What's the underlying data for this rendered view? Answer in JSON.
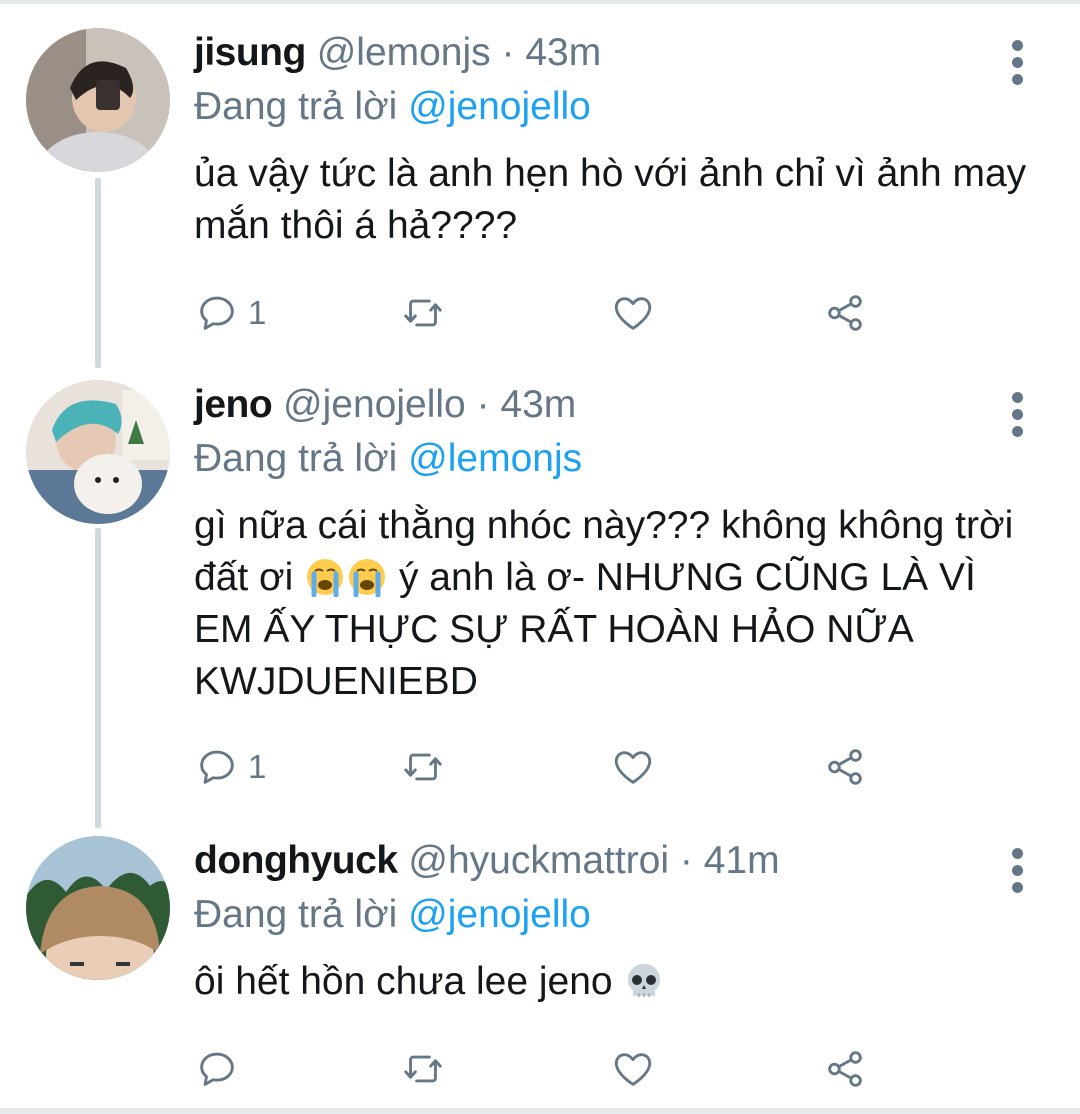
{
  "replies": [
    {
      "name": "jisung",
      "handle": "@lemonjs",
      "time": "· 43m",
      "replying_prefix": "Đang trả lời",
      "replying_to": "@jenojello",
      "text_parts": [
        "ủa vậy tức là anh hẹn hò với ảnh chỉ vì ảnh may mắn thôi á hả????"
      ],
      "reply_count": "1",
      "avatar_colors": {
        "bg": "#c9c2ba",
        "hair": "#2b2320",
        "skin": "#e3c6b0"
      }
    },
    {
      "name": "jeno",
      "handle": "@jenojello",
      "time": "· 43m",
      "replying_prefix": "Đang trả lời",
      "replying_to": "@lemonjs",
      "text_parts": [
        "gì nữa cái thằng nhóc này??? không không trời đất ơi ",
        " ý anh là ơ- NHƯNG CŨNG LÀ VÌ EM ẤY THỰC SỰ RẤT HOÀN HẢO NỮA KWJDUENIEBD"
      ],
      "emoji": [
        "loudly-crying-face",
        "loudly-crying-face"
      ],
      "reply_count": "1",
      "avatar_colors": {
        "bg": "#e9e2da",
        "hair": "#4bb3b7",
        "skin": "#e6c9b4"
      }
    },
    {
      "name": "donghyuck",
      "handle": "@hyuckmattroi",
      "time": "· 41m",
      "replying_prefix": "Đang trả lời",
      "replying_to": "@jenojello",
      "text_parts": [
        "ôi hết hồn chưa lee jeno "
      ],
      "emoji": [
        "skull"
      ],
      "reply_count": "",
      "avatar_colors": {
        "bg": "#a9c3d6",
        "hair": "#b08a62",
        "skin": "#e9cdb6"
      }
    }
  ],
  "icons": {
    "reply": "speech-bubble-icon",
    "retweet": "retweet-icon",
    "like": "heart-icon",
    "share": "share-icon",
    "more": "vertical-dots-icon"
  },
  "colors": {
    "name": "#14171a",
    "meta": "#657786",
    "mention": "#1da1f2",
    "thread_line": "#cfd9de"
  }
}
